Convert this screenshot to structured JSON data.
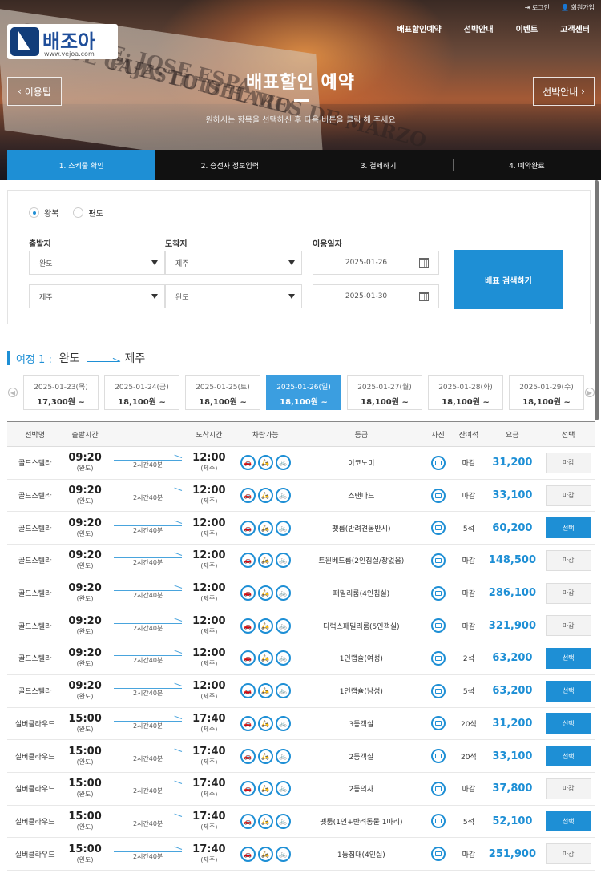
{
  "header": {
    "logo_text": "배조아",
    "logo_url": "www.vejoa.com",
    "util": [
      "로그인",
      "회원가입"
    ],
    "nav": [
      "배표할인예약",
      "선박안내",
      "이벤트",
      "고객센터"
    ],
    "hero_title": "배표할인 예약",
    "hero_sub": "원하시는 항목을 선택하신 후 다음 버튼을 클릭 해 주세요",
    "left_button": "이용팁",
    "right_button": "선박안내",
    "paper_lines": [
      "GERENTE: JOSE ESPA",
      "RDE CAJA: LUIS HARO",
      "PUESTO DEL MES DE MARZO"
    ]
  },
  "steps": [
    "1. 스케줄 확인",
    "2. 승선자 정보입력",
    "3. 결제하기",
    "4. 예약완료"
  ],
  "search": {
    "trip_types": [
      "왕복",
      "편도"
    ],
    "labels": {
      "from": "출발지",
      "to": "도착지",
      "date": "이용일자"
    },
    "row1": {
      "from": "완도",
      "to": "제주",
      "date": "2025-01-26"
    },
    "row2": {
      "from": "제주",
      "to": "완도",
      "date": "2025-01-30"
    },
    "button": "배표 검색하기"
  },
  "trip": {
    "label": "여정 1 :",
    "from": "완도",
    "to": "제주"
  },
  "dates": [
    {
      "date": "2025-01-23(목)",
      "price": "17,300원 ~"
    },
    {
      "date": "2025-01-24(금)",
      "price": "18,100원 ~"
    },
    {
      "date": "2025-01-25(토)",
      "price": "18,100원 ~"
    },
    {
      "date": "2025-01-26(일)",
      "price": "18,100원 ~"
    },
    {
      "date": "2025-01-27(월)",
      "price": "18,100원 ~"
    },
    {
      "date": "2025-01-28(화)",
      "price": "18,100원 ~"
    },
    {
      "date": "2025-01-29(수)",
      "price": "18,100원 ~"
    }
  ],
  "table": {
    "headers": [
      "선박명",
      "출발시간",
      "",
      "도착시간",
      "차량가능",
      "등급",
      "사진",
      "잔여석",
      "요금",
      "선택"
    ],
    "vehicle_icons": [
      "car-icon",
      "motorcycle-icon",
      "bicycle-icon"
    ],
    "rows": [
      {
        "ship": "골드스텔라",
        "dep": "09:20",
        "dep_port": "(완도)",
        "dur": "2시간40분",
        "arr": "12:00",
        "arr_port": "(제주)",
        "grade": "이코노미",
        "seats": "마감",
        "fare": "31,200",
        "btn": "마감"
      },
      {
        "ship": "골드스텔라",
        "dep": "09:20",
        "dep_port": "(완도)",
        "dur": "2시간40분",
        "arr": "12:00",
        "arr_port": "(제주)",
        "grade": "스탠다드",
        "seats": "마감",
        "fare": "33,100",
        "btn": "마감"
      },
      {
        "ship": "골드스텔라",
        "dep": "09:20",
        "dep_port": "(완도)",
        "dur": "2시간40분",
        "arr": "12:00",
        "arr_port": "(제주)",
        "grade": "펫룸(반려견동반시)",
        "seats": "5석",
        "fare": "60,200",
        "btn": "선택"
      },
      {
        "ship": "골드스텔라",
        "dep": "09:20",
        "dep_port": "(완도)",
        "dur": "2시간40분",
        "arr": "12:00",
        "arr_port": "(제주)",
        "grade": "트윈베드룸(2인침실/창없음)",
        "seats": "마감",
        "fare": "148,500",
        "btn": "마감"
      },
      {
        "ship": "골드스텔라",
        "dep": "09:20",
        "dep_port": "(완도)",
        "dur": "2시간40분",
        "arr": "12:00",
        "arr_port": "(제주)",
        "grade": "패밀리룸(4인침실)",
        "seats": "마감",
        "fare": "286,100",
        "btn": "마감"
      },
      {
        "ship": "골드스텔라",
        "dep": "09:20",
        "dep_port": "(완도)",
        "dur": "2시간40분",
        "arr": "12:00",
        "arr_port": "(제주)",
        "grade": "디럭스패밀리룸(5인객실)",
        "seats": "마감",
        "fare": "321,900",
        "btn": "마감"
      },
      {
        "ship": "골드스텔라",
        "dep": "09:20",
        "dep_port": "(완도)",
        "dur": "2시간40분",
        "arr": "12:00",
        "arr_port": "(제주)",
        "grade": "1인캡슐(여성)",
        "seats": "2석",
        "fare": "63,200",
        "btn": "선택"
      },
      {
        "ship": "골드스텔라",
        "dep": "09:20",
        "dep_port": "(완도)",
        "dur": "2시간40분",
        "arr": "12:00",
        "arr_port": "(제주)",
        "grade": "1인캡슐(남성)",
        "seats": "5석",
        "fare": "63,200",
        "btn": "선택"
      },
      {
        "ship": "실버클라우드",
        "dep": "15:00",
        "dep_port": "(완도)",
        "dur": "2시간40분",
        "arr": "17:40",
        "arr_port": "(제주)",
        "grade": "3등객실",
        "seats": "20석",
        "fare": "31,200",
        "btn": "선택"
      },
      {
        "ship": "실버클라우드",
        "dep": "15:00",
        "dep_port": "(완도)",
        "dur": "2시간40분",
        "arr": "17:40",
        "arr_port": "(제주)",
        "grade": "2등객실",
        "seats": "20석",
        "fare": "33,100",
        "btn": "선택"
      },
      {
        "ship": "실버클라우드",
        "dep": "15:00",
        "dep_port": "(완도)",
        "dur": "2시간40분",
        "arr": "17:40",
        "arr_port": "(제주)",
        "grade": "2등의자",
        "seats": "마감",
        "fare": "37,800",
        "btn": "마감"
      },
      {
        "ship": "실버클라우드",
        "dep": "15:00",
        "dep_port": "(완도)",
        "dur": "2시간40분",
        "arr": "17:40",
        "arr_port": "(제주)",
        "grade": "펫룸(1인+반려동물 1마리)",
        "seats": "5석",
        "fare": "52,100",
        "btn": "선택"
      },
      {
        "ship": "실버클라우드",
        "dep": "15:00",
        "dep_port": "(완도)",
        "dur": "2시간40분",
        "arr": "17:40",
        "arr_port": "(제주)",
        "grade": "1등침대(4인실)",
        "seats": "마감",
        "fare": "251,900",
        "btn": "마감"
      }
    ]
  },
  "colors": {
    "accent": "#1e8fd5",
    "dark": "#111111"
  }
}
